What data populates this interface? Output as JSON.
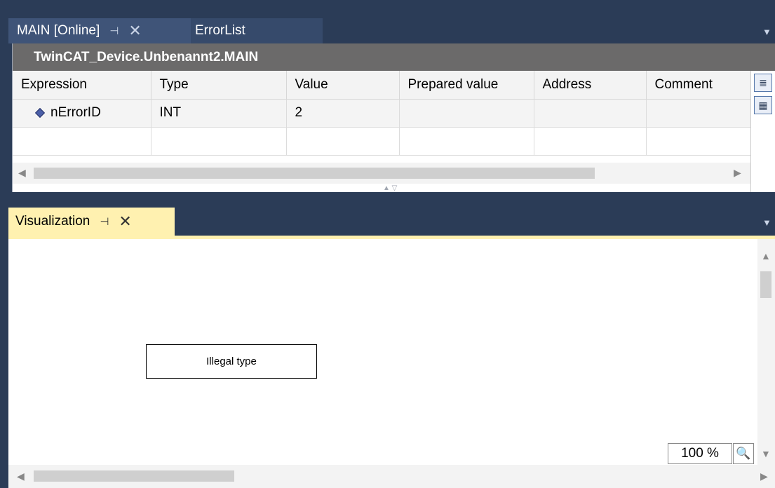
{
  "document_tabs": [
    {
      "label": "MAIN [Online]",
      "active": true
    },
    {
      "label": "ErrorList",
      "active": false
    }
  ],
  "icons": {
    "pin": "⊣",
    "close": "✕",
    "dropdown": "▼"
  },
  "watch_panel": {
    "path": "TwinCAT_Device.Unbenannt2.MAIN",
    "columns": [
      "Expression",
      "Type",
      "Value",
      "Prepared value",
      "Address",
      "Comment"
    ],
    "rows": [
      {
        "expression": "nErrorID",
        "type": "INT",
        "value": "2",
        "prepared_value": "",
        "address": "",
        "comment": ""
      }
    ]
  },
  "visualization_tab": {
    "label": "Visualization"
  },
  "visualization": {
    "element_text": "Illegal type",
    "zoom": "100 %"
  },
  "colors": {
    "ide_background": "#2b3c57",
    "active_tab": "#3f5478",
    "vis_tab_accent": "#fff1b0",
    "path_bar": "#6b6a6a"
  }
}
